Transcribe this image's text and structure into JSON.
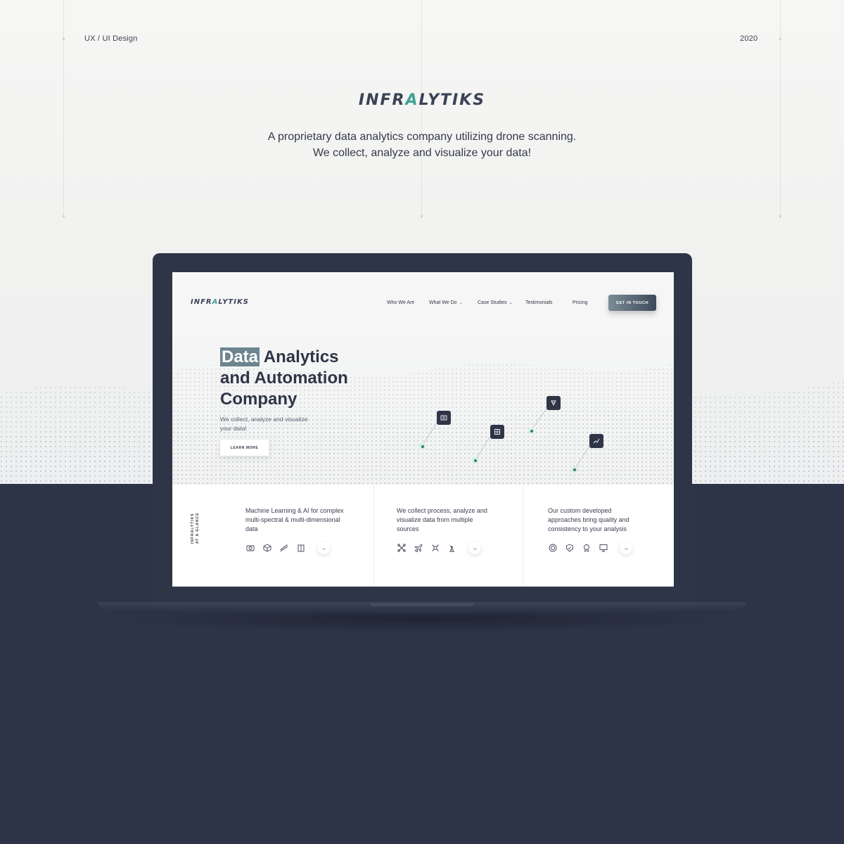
{
  "presentation": {
    "category": "UX / UI Design",
    "year": "2020",
    "logo": {
      "part1": "INFR",
      "accent": "A",
      "part2": "LYTIKS"
    },
    "tagline_line1": "A proprietary data analytics company utilizing drone scanning.",
    "tagline_line2": "We collect, analyze and visualize your data!"
  },
  "site": {
    "logo": {
      "part1": "INFR",
      "accent": "A",
      "part2": "LYTIKS"
    },
    "nav": [
      {
        "label": "Who We Are",
        "has_dropdown": false
      },
      {
        "label": "What We Do",
        "has_dropdown": true
      },
      {
        "label": "Case Studies",
        "has_dropdown": true
      },
      {
        "label": "Testimonials",
        "has_dropdown": false
      },
      {
        "label": "Pricing",
        "has_dropdown": false
      }
    ],
    "cta_label": "GET IN TOUCH",
    "hero": {
      "title_highlight": "Data",
      "title_rest_line1": " Analytics",
      "title_line2": "and Automation",
      "title_line3": "Company",
      "subtitle": "We collect, analyze and visualize your data!",
      "button_label": "LEARN MORE"
    },
    "glance_label_line1": "INFRALYTIKS",
    "glance_label_line2": "AT A GLANCE",
    "features": [
      {
        "text": "Machine Learning & AI for complex multi-spectral & multi-dimensional data",
        "icons": [
          "camera-icon",
          "cube-icon",
          "waves-icon",
          "building-icon"
        ]
      },
      {
        "text": "We collect process, analyze and visualize data from multiple sources",
        "icons": [
          "drone-icon",
          "airplane-icon",
          "quadcopter-icon",
          "robot-arm-icon"
        ]
      },
      {
        "text": "Our custom developed approaches bring quality and consistency to your analysis",
        "icons": [
          "target-icon",
          "shield-icon",
          "award-icon",
          "monitor-icon"
        ]
      }
    ]
  },
  "colors": {
    "navy": "#2d3447",
    "accent_teal": "#3ea394",
    "highlight": "#6c8590",
    "pin_green": "#2f7f6d"
  }
}
